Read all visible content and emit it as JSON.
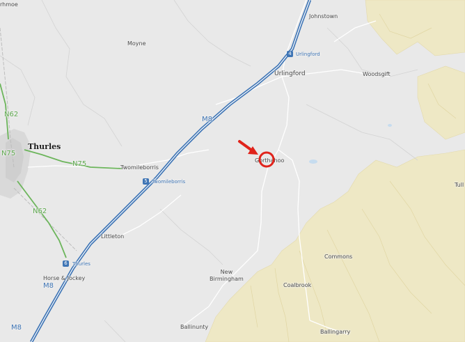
{
  "map": {
    "places": {
      "rahmoe": "rhmoe",
      "johnstown": "Johnstown",
      "moyne": "Moyne",
      "urlingford": "Urlingford",
      "woodsgift": "Woodsgift",
      "thurles": "Thurles",
      "twomileborris": "Twomileborris",
      "gorthahoo": "Gorthahoo",
      "tull": "Tull",
      "littleton": "Littleton",
      "commons": "Commons",
      "horse_jockey": "Horse & Jockey",
      "new_birmingham": "New\nBirmingham",
      "coalbrook": "Coalbrook",
      "ballinunty": "Ballinunty",
      "ballingarry": "Ballingarry"
    },
    "roads": {
      "m8_a": "M8",
      "m8_b": "M8",
      "m8_c": "M8",
      "n62_a": "N62",
      "n62_b": "N62",
      "n75_a": "N75",
      "n75_b": "N75"
    },
    "junctions": {
      "urlingford": {
        "number": "4",
        "name": "Urlingford"
      },
      "twomileborris": {
        "number": "5",
        "name": "Twomileborris"
      },
      "thurles": {
        "number": "6",
        "name": "Thurles"
      }
    },
    "marker": {
      "type": "red circle with arrow",
      "color": "#e0231b"
    },
    "colors": {
      "background": "#e9e9e9",
      "motorway": "#3f75b5",
      "national_road": "#5ea84e",
      "hills": "#efe8c4",
      "town": "#d8d8d8"
    }
  }
}
